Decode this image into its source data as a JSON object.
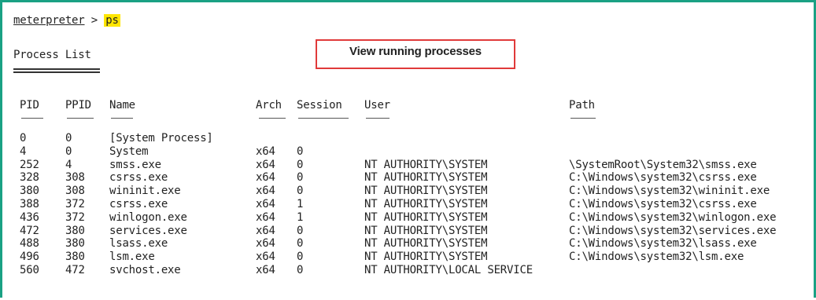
{
  "prompt": {
    "label": "meterpreter",
    "separator": ">",
    "command": "ps"
  },
  "title": "Process List",
  "callout": "View running processes",
  "columns": [
    "PID",
    "PPID",
    "Name",
    "Arch",
    "Session",
    "User",
    "Path"
  ],
  "rows": [
    [
      "0",
      "0",
      "[System Process]",
      "",
      "",
      "",
      ""
    ],
    [
      "4",
      "0",
      "System",
      "x64",
      "0",
      "",
      ""
    ],
    [
      "252",
      "4",
      "smss.exe",
      "x64",
      "0",
      "NT AUTHORITY\\SYSTEM",
      "\\SystemRoot\\System32\\smss.exe"
    ],
    [
      "328",
      "308",
      "csrss.exe",
      "x64",
      "0",
      "NT AUTHORITY\\SYSTEM",
      "C:\\Windows\\system32\\csrss.exe"
    ],
    [
      "380",
      "308",
      "wininit.exe",
      "x64",
      "0",
      "NT AUTHORITY\\SYSTEM",
      "C:\\Windows\\system32\\wininit.exe"
    ],
    [
      "388",
      "372",
      "csrss.exe",
      "x64",
      "1",
      "NT AUTHORITY\\SYSTEM",
      "C:\\Windows\\system32\\csrss.exe"
    ],
    [
      "436",
      "372",
      "winlogon.exe",
      "x64",
      "1",
      "NT AUTHORITY\\SYSTEM",
      "C:\\Windows\\system32\\winlogon.exe"
    ],
    [
      "472",
      "380",
      "services.exe",
      "x64",
      "0",
      "NT AUTHORITY\\SYSTEM",
      "C:\\Windows\\system32\\services.exe"
    ],
    [
      "488",
      "380",
      "lsass.exe",
      "x64",
      "0",
      "NT AUTHORITY\\SYSTEM",
      "C:\\Windows\\system32\\lsass.exe"
    ],
    [
      "496",
      "380",
      "lsm.exe",
      "x64",
      "0",
      "NT AUTHORITY\\SYSTEM",
      "C:\\Windows\\system32\\lsm.exe"
    ],
    [
      "560",
      "472",
      "svchost.exe",
      "x64",
      "0",
      "NT AUTHORITY\\LOCAL SERVICE",
      ""
    ]
  ],
  "colors": {
    "frame": "#1aa184",
    "callout_border": "#e03a3a",
    "highlight": "#ffe600",
    "text": "#222222"
  }
}
